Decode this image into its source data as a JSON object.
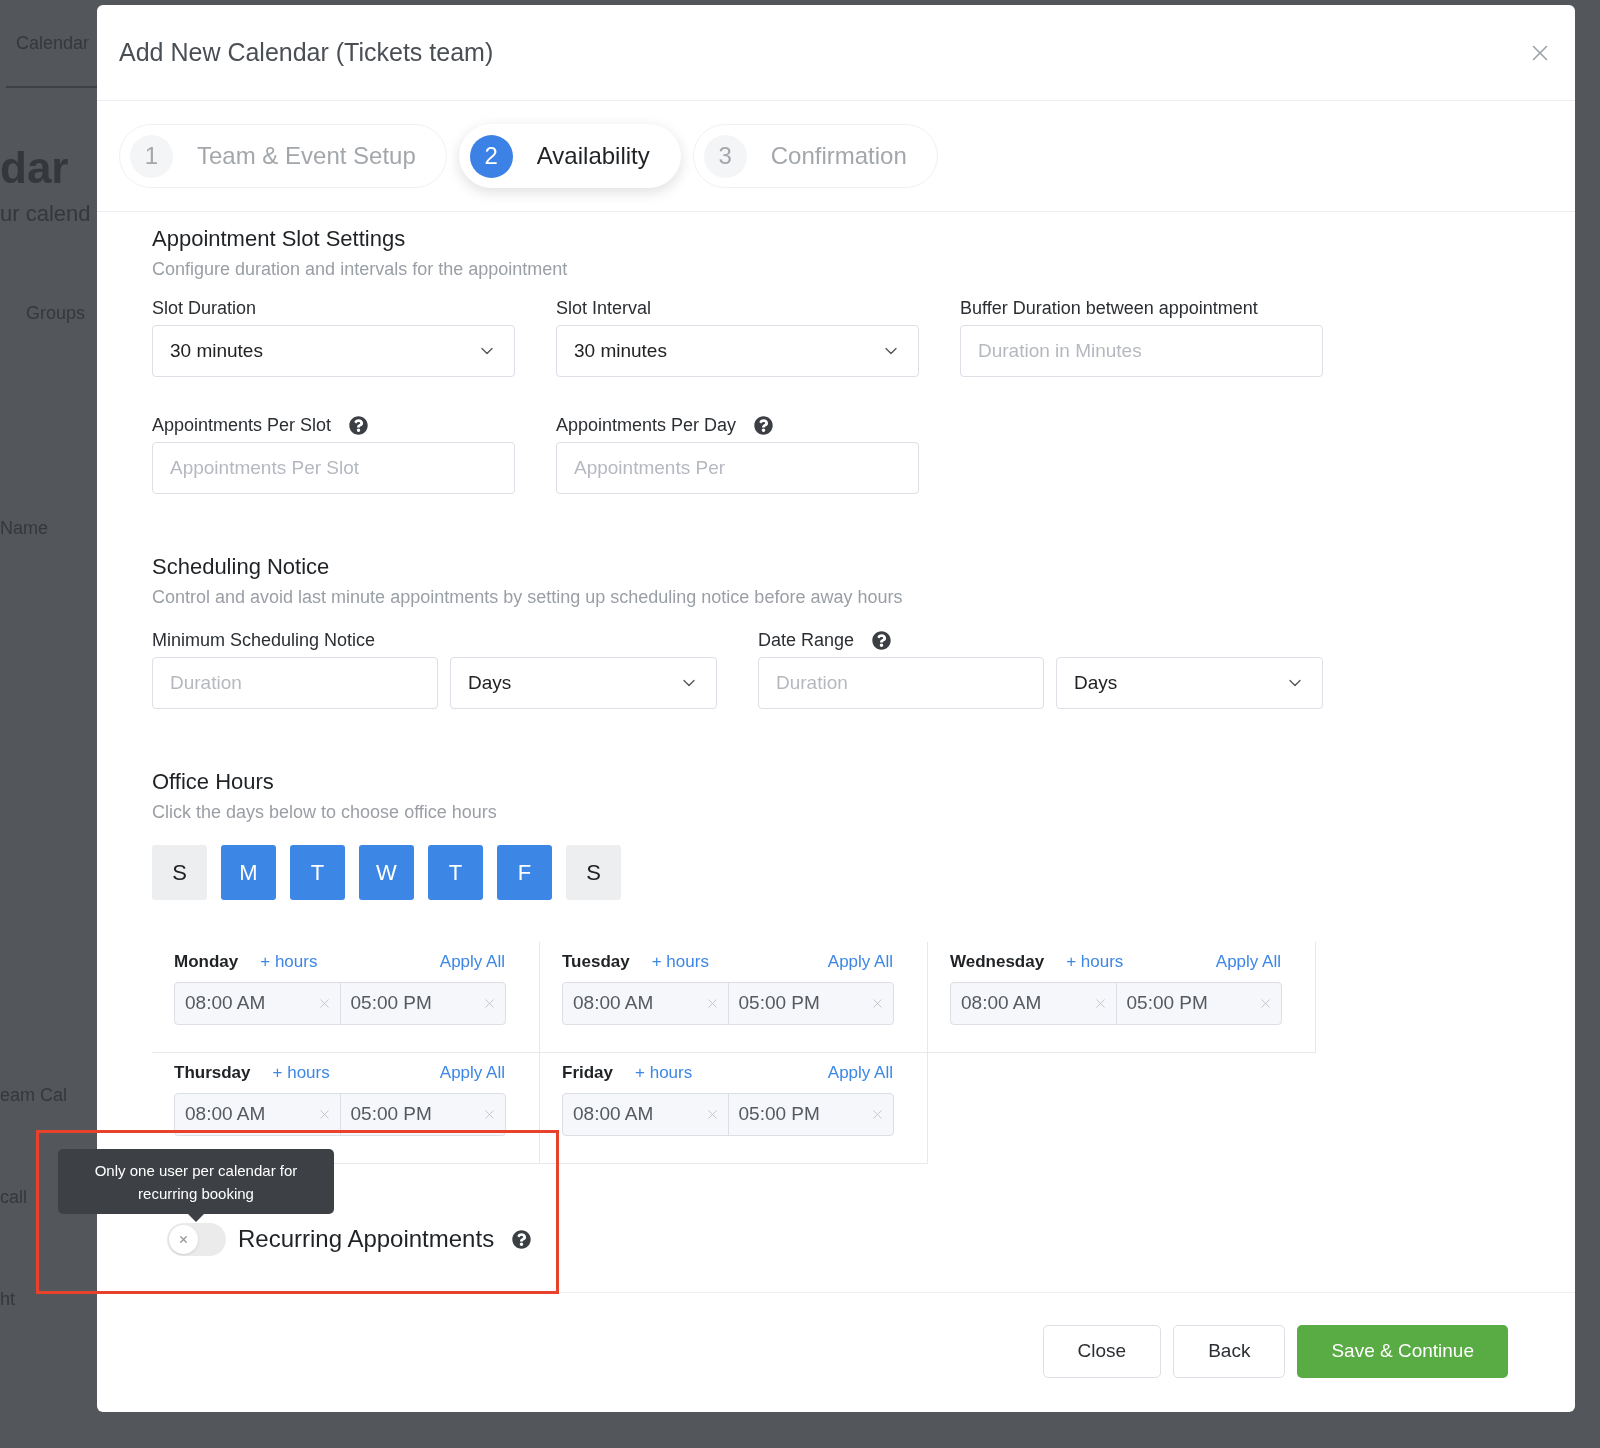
{
  "background": {
    "tab": "Calendar",
    "heading": "dar",
    "subheading": "ur calend",
    "items": [
      "Groups",
      "Name",
      "eam Cal",
      "call",
      "ht"
    ]
  },
  "modal": {
    "title": "Add New Calendar (Tickets team)",
    "steps": [
      {
        "number": "1",
        "label": "Team & Event Setup",
        "selected": false
      },
      {
        "number": "2",
        "label": "Availability",
        "selected": true
      },
      {
        "number": "3",
        "label": "Confirmation",
        "selected": false
      }
    ],
    "slot_settings": {
      "title": "Appointment Slot Settings",
      "subtitle": "Configure duration and intervals for the appointment",
      "fields": [
        {
          "label": "Slot Duration",
          "kind": "select",
          "value": "30 minutes",
          "help": false
        },
        {
          "label": "Slot Interval",
          "kind": "select",
          "value": "30 minutes",
          "help": false
        },
        {
          "label": "Buffer Duration between appointment",
          "kind": "input",
          "placeholder": "Duration in Minutes",
          "help": false
        },
        {
          "label": "Appointments Per Slot",
          "kind": "input",
          "placeholder": "Appointments Per Slot",
          "help": true
        },
        {
          "label": "Appointments Per Day",
          "kind": "input",
          "placeholder": "Appointments Per",
          "help": true
        }
      ]
    },
    "scheduling_notice": {
      "title": "Scheduling Notice",
      "subtitle": "Control and avoid last minute appointments by setting up scheduling notice before away hours",
      "groups": [
        {
          "label": "Minimum Scheduling Notice",
          "help": false,
          "placeholder": "Duration",
          "unit": "Days"
        },
        {
          "label": "Date Range",
          "help": true,
          "placeholder": "Duration",
          "unit": "Days"
        }
      ]
    },
    "office_hours": {
      "title": "Office Hours",
      "subtitle": "Click the days below to choose office hours",
      "days": [
        {
          "letter": "S",
          "selected": false
        },
        {
          "letter": "M",
          "selected": true
        },
        {
          "letter": "T",
          "selected": true
        },
        {
          "letter": "W",
          "selected": true
        },
        {
          "letter": "T",
          "selected": true
        },
        {
          "letter": "F",
          "selected": true
        },
        {
          "letter": "S",
          "selected": false
        }
      ],
      "schedule": [
        {
          "day": "Monday",
          "add": "+ hours",
          "apply": "Apply All",
          "start": "08:00 AM",
          "end": "05:00 PM"
        },
        {
          "day": "Tuesday",
          "add": "+ hours",
          "apply": "Apply All",
          "start": "08:00 AM",
          "end": "05:00 PM"
        },
        {
          "day": "Wednesday",
          "add": "+ hours",
          "apply": "Apply All",
          "start": "08:00 AM",
          "end": "05:00 PM"
        },
        {
          "day": "Thursday",
          "add": "+ hours",
          "apply": "Apply All",
          "start": "08:00 AM",
          "end": "05:00 PM"
        },
        {
          "day": "Friday",
          "add": "+ hours",
          "apply": "Apply All",
          "start": "08:00 AM",
          "end": "05:00 PM"
        }
      ]
    },
    "recurring": {
      "label": "Recurring Appointments",
      "on": false,
      "tooltip": "Only one user per calendar for recurring booking"
    },
    "buttons": [
      {
        "label": "Close",
        "kind": "secondary"
      },
      {
        "label": "Back",
        "kind": "secondary"
      },
      {
        "label": "Save & Continue",
        "kind": "primary"
      }
    ]
  }
}
